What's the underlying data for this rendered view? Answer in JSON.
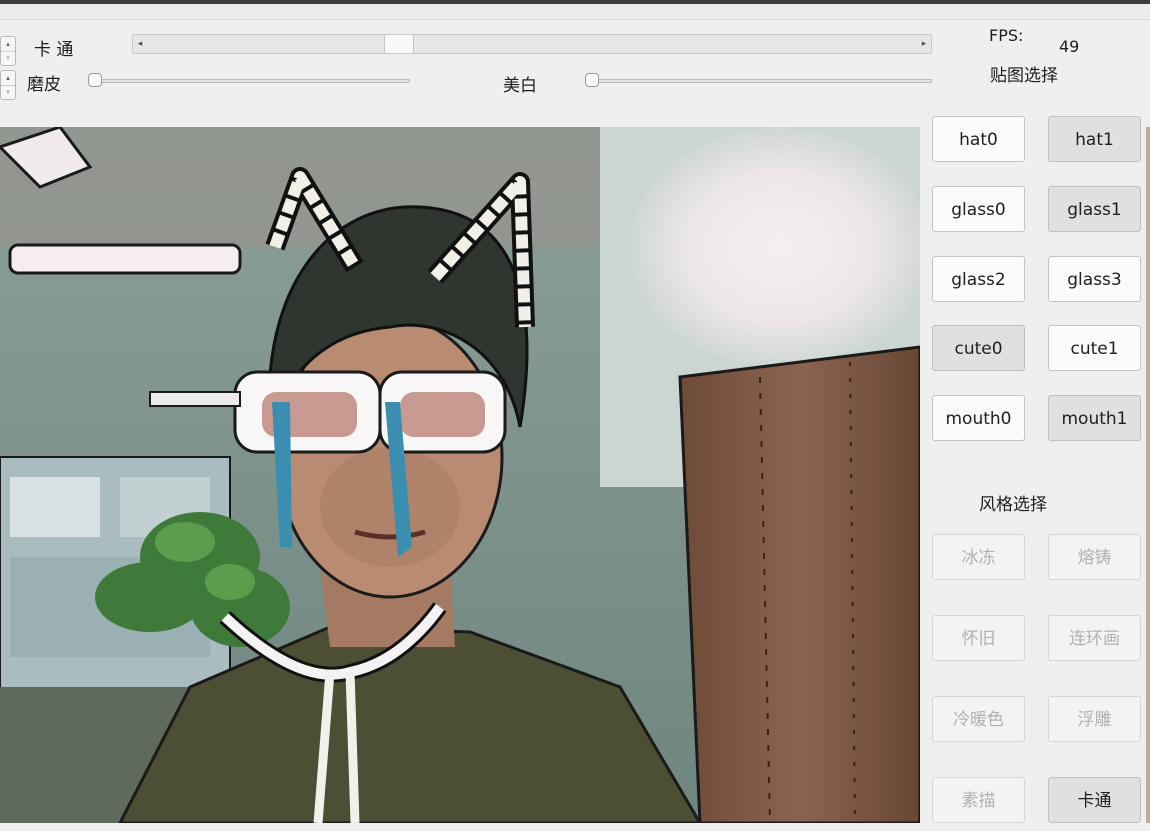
{
  "controls": {
    "cartoon_label": "卡 通",
    "buffing_label": "磨皮",
    "whitening_label": "美白",
    "scroll_left_glyph": "◂",
    "scroll_right_glyph": "▸",
    "spinner_up_glyph": "▴",
    "spinner_down_glyph": "▾",
    "cartoon_scroll_position": 0.32,
    "buffing_level": 0.0,
    "whitening_level": 0.0
  },
  "status": {
    "fps_label": "FPS:",
    "fps_value": "49"
  },
  "stickers": {
    "title": "贴图选择",
    "buttons": [
      {
        "label": "hat0",
        "pressed": false
      },
      {
        "label": "hat1",
        "pressed": true
      },
      {
        "label": "glass0",
        "pressed": false
      },
      {
        "label": "glass1",
        "pressed": true
      },
      {
        "label": "glass2",
        "pressed": false
      },
      {
        "label": "glass3",
        "pressed": false
      },
      {
        "label": "cute0",
        "pressed": true
      },
      {
        "label": "cute1",
        "pressed": false
      },
      {
        "label": "mouth0",
        "pressed": false
      },
      {
        "label": "mouth1",
        "pressed": true
      }
    ]
  },
  "styles": {
    "title": "风格选择",
    "buttons": [
      {
        "label": "冰冻",
        "disabled": true
      },
      {
        "label": "熔铸",
        "disabled": true
      },
      {
        "label": "怀旧",
        "disabled": true
      },
      {
        "label": "连环画",
        "disabled": true
      },
      {
        "label": "冷暖色",
        "disabled": true
      },
      {
        "label": "浮雕",
        "disabled": true
      },
      {
        "label": "素描",
        "disabled": true
      },
      {
        "label": "卡通",
        "disabled": false,
        "pressed": true
      }
    ]
  },
  "colors": {
    "accent_border": "#c7a89b",
    "button_pressed": "#e0e0e0",
    "button_disabled_text": "#b1b1b1"
  }
}
